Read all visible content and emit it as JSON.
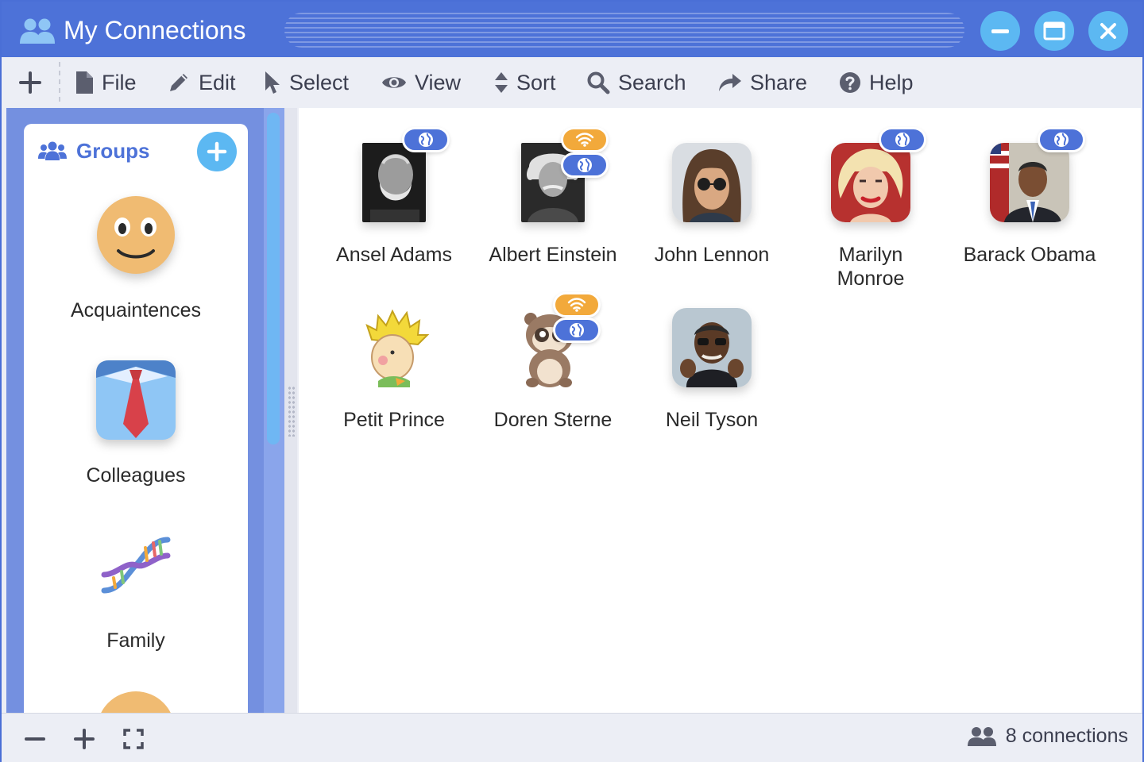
{
  "window": {
    "title": "My Connections",
    "accent": "#4d72d8",
    "button_color": "#5cb8f2"
  },
  "toolbar": {
    "items": [
      {
        "label": "File",
        "icon": "file-icon"
      },
      {
        "label": "Edit",
        "icon": "pencil-icon"
      },
      {
        "label": "Select",
        "icon": "cursor-icon"
      },
      {
        "label": "View",
        "icon": "eye-icon"
      },
      {
        "label": "Sort",
        "icon": "sort-icon"
      },
      {
        "label": "Search",
        "icon": "search-icon"
      },
      {
        "label": "Share",
        "icon": "share-icon"
      },
      {
        "label": "Help",
        "icon": "help-icon"
      }
    ]
  },
  "sidebar": {
    "title": "Groups",
    "groups": [
      {
        "label": "Acquaintences",
        "icon": "smiley-face-icon"
      },
      {
        "label": "Colleagues",
        "icon": "shirt-tie-icon"
      },
      {
        "label": "Family",
        "icon": "dna-icon"
      }
    ]
  },
  "connections": [
    {
      "name": "Ansel Adams",
      "badges": [
        "globe"
      ]
    },
    {
      "name": "Albert Einstein",
      "badges": [
        "wifi",
        "globe"
      ]
    },
    {
      "name": "John Lennon",
      "badges": []
    },
    {
      "name": "Marilyn Monroe",
      "badges": [
        "globe"
      ]
    },
    {
      "name": "Barack Obama",
      "badges": [
        "globe"
      ]
    },
    {
      "name": "Petit Prince",
      "badges": []
    },
    {
      "name": "Doren Sterne",
      "badges": [
        "wifi",
        "globe"
      ]
    },
    {
      "name": "Neil Tyson",
      "badges": []
    }
  ],
  "status": {
    "count_text": "8 connections"
  }
}
